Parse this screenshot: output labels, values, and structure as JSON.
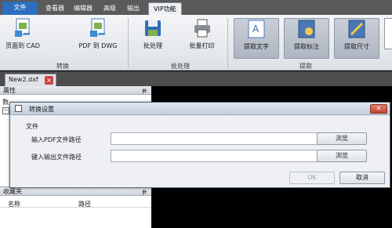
{
  "ribbon_tabs": [
    "文件",
    "查看器",
    "编辑器",
    "高级",
    "输出",
    "VIP功能"
  ],
  "ribbon": {
    "buttons": [
      "页面到 CAD",
      "PDF 到 DWG",
      "批处理",
      "批量打印",
      "提取文字",
      "提取标注",
      "提取尺寸"
    ],
    "groups": [
      "转换",
      "批处理",
      "提取"
    ]
  },
  "document_tab": {
    "label": "New2.dxf",
    "close": "×"
  },
  "left_panel": {
    "title": "属性",
    "pin": "ᵽ",
    "partial_label": "数"
  },
  "favorites": {
    "title": "收藏夹",
    "pin": "ᵽ",
    "col_name": "名称",
    "col_path": "路径"
  },
  "dialog": {
    "title": "转换设置",
    "close": "✕",
    "section": "文件",
    "input_label": "输入PDF文件路径",
    "input_value": "",
    "output_label": "键入输出文件路径",
    "output_value": "",
    "browse_label": "浏览",
    "ok_label": "OK",
    "cancel_label": "取消"
  },
  "colors": {
    "file_tab": "#2c6fbf",
    "ribbon_bg": "#dde1e6",
    "canvas": "#000000"
  }
}
